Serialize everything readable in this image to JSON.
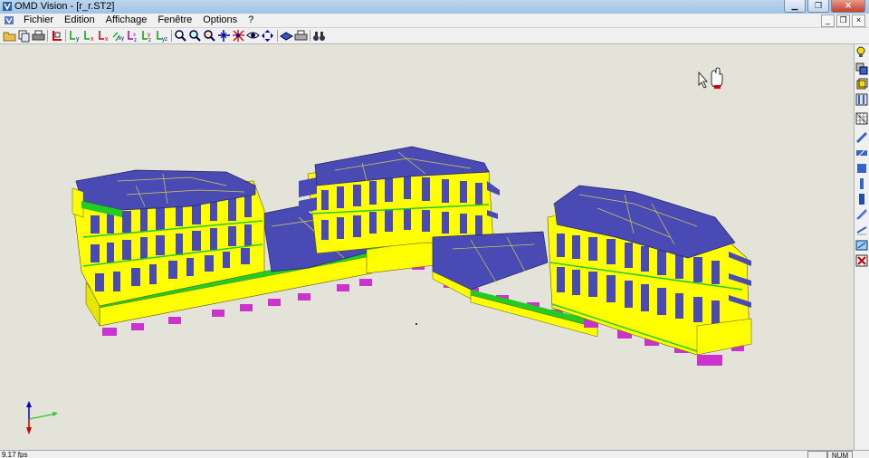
{
  "window": {
    "title": "OMD Vision - [r_r.ST2]"
  },
  "menu": {
    "items": [
      "Fichier",
      "Edition",
      "Affichage",
      "Fenêtre",
      "Options",
      "?"
    ]
  },
  "toolbar": {
    "icons": [
      "open-icon",
      "copy-icon",
      "print-icon",
      "axis-origin-icon",
      "view-y-icon",
      "view-x-icon",
      "view-x2-icon",
      "view-xy-icon",
      "view-iso-icon",
      "view-xyz-icon",
      "view-yz-icon",
      "zoom-window-icon",
      "zoom-in-icon",
      "zoom-out-icon",
      "zoom-all-icon",
      "explode-icon",
      "eye-icon",
      "move-icon",
      "render-icon",
      "print-preview-icon",
      "binoculars-icon"
    ]
  },
  "sidebar": {
    "icons": [
      "lightbulb-icon",
      "layers-icon",
      "cube-icon",
      "columns-icon",
      "grid-icon",
      "beam-icon",
      "slab-icon",
      "wall-icon",
      "panel-icon",
      "pillar-icon",
      "rebar-icon",
      "diagonal-icon",
      "foundation-icon",
      "delete-icon"
    ]
  },
  "status": {
    "fps": "9.17 fps",
    "num": "NUM"
  },
  "colors": {
    "walls": "#ffff00",
    "roofs": "#4a4ab4",
    "floors": "#22cc22",
    "footings": "#cc33cc",
    "background": "#e4e3da"
  }
}
